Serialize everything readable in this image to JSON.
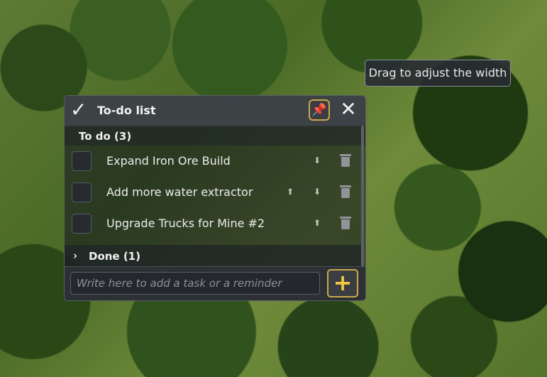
{
  "tooltip": {
    "text": "Drag to adjust the width"
  },
  "panel": {
    "title": "To-do list",
    "check_icon": "checkmark-icon",
    "pin_icon": "pin-icon",
    "close_icon": "close-icon",
    "todo_section": {
      "label": "To do (3)"
    },
    "tasks": [
      {
        "label": "Expand Iron Ore Build",
        "move_up": false,
        "move_down": true
      },
      {
        "label": "Add more water extractor",
        "move_up": true,
        "move_down": true
      },
      {
        "label": "Upgrade Trucks for Mine #2",
        "move_up": true,
        "move_down": false
      }
    ],
    "done_section": {
      "label": "Done (1)",
      "expanded": false
    },
    "input": {
      "value": "",
      "placeholder": "Write here to add a task or a reminder"
    },
    "add_button": {
      "label": "+"
    }
  },
  "colors": {
    "accent": "#c8a949",
    "panel_bg": "#1a1e22",
    "header_bg": "#3e4248"
  }
}
